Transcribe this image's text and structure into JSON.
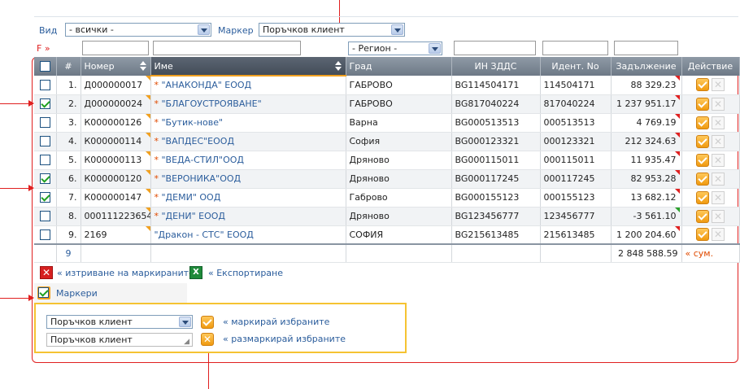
{
  "filters": {
    "view_label": "Вид",
    "view_value": "- всички -",
    "marker_label": "Маркер",
    "marker_value": "Поръчков клиент",
    "f_label": "F »",
    "region_value": "- Регион -"
  },
  "columns": [
    "#",
    "Номер",
    "Име",
    "Град",
    "ИН ЗДДС",
    "Идент. No",
    "Задължение",
    "Действие"
  ],
  "rows": [
    {
      "n": "1.",
      "num": "Д000000017",
      "name": "\"АНАКОНДА\" ЕООД",
      "star": true,
      "city": "ГАБРОВО",
      "vat": "BG114504171",
      "id": "114504171",
      "debt": "88 329.23",
      "flag": "red",
      "checked": false
    },
    {
      "n": "2.",
      "num": "Д000000024",
      "name": "\"БЛАГОУСТРОЯВАНЕ\"",
      "star": true,
      "city": "ГАБРОВО",
      "vat": "BG817040224",
      "id": "817040224",
      "debt": "1 237 951.17",
      "flag": "red",
      "checked": true
    },
    {
      "n": "3.",
      "num": "К000000126",
      "name": "\"Бутик-нове\"",
      "star": true,
      "city": "Варна",
      "vat": "BG000513513",
      "id": "000513513",
      "debt": "4 769.19",
      "flag": "red",
      "checked": false
    },
    {
      "n": "4.",
      "num": "К000000114",
      "name": "\"ВАПДЕС\"ЕООД",
      "star": true,
      "city": "София",
      "vat": "BG000123321",
      "id": "000123321",
      "debt": "212 324.63",
      "flag": "red",
      "checked": false
    },
    {
      "n": "5.",
      "num": "К000000113",
      "name": "\"ВЕДА-СТИЛ\"ООД",
      "star": true,
      "city": "Дряново",
      "vat": "BG000115011",
      "id": "000115011",
      "debt": "11 935.47",
      "flag": "red",
      "checked": false
    },
    {
      "n": "6.",
      "num": "К000000120",
      "name": "\"ВЕРОНИКА\"ООД",
      "star": true,
      "city": "Дряново",
      "vat": "BG000117245",
      "id": "000117245",
      "debt": "82 953.28",
      "flag": "red",
      "checked": true
    },
    {
      "n": "7.",
      "num": "К000000147",
      "name": "\"ДЕМИ\" ООД",
      "star": true,
      "city": "Габрово",
      "vat": "BG000155123",
      "id": "000155123",
      "debt": "13 682.12",
      "flag": "red",
      "checked": true
    },
    {
      "n": "8.",
      "num": "000111223654",
      "name": "\"ДЕНИ\" ЕООД",
      "star": true,
      "city": "Дряново",
      "vat": "BG123456777",
      "id": "123456777",
      "debt": "-3 561.10",
      "flag": "green",
      "checked": false
    },
    {
      "n": "9.",
      "num": "2169",
      "name": "\"Дракон - СТС\" ЕООД",
      "star": false,
      "city": "СОФИЯ",
      "vat": "BG215613485",
      "id": "215613485",
      "debt": "1 200 204.60",
      "flag": "red",
      "checked": false
    }
  ],
  "totals": {
    "count": "9",
    "sum": "2 848 588.59",
    "sum_link": "« сум."
  },
  "actions": {
    "delete_markers": "« изтриване на маркираните",
    "export": "« Експортиране"
  },
  "markers": {
    "label": "Маркери",
    "select_value": "Поръчков клиент",
    "text_value": "Поръчков клиент",
    "mark_link": "« маркирай избраните",
    "unmark_link": "« размаркирай избраните"
  },
  "colors": {
    "accent": "#2b5d9c",
    "highlight": "#f0a020",
    "annotation": "#e02020"
  }
}
